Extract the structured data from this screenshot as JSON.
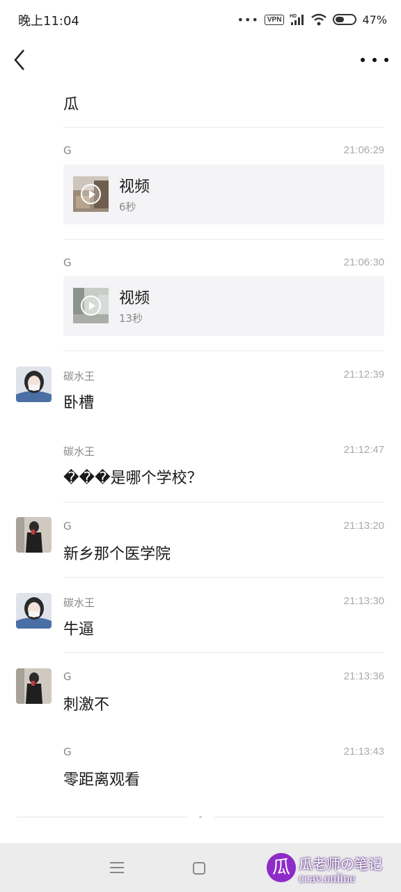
{
  "status_bar": {
    "time": "晚上11:04",
    "dots": "•••",
    "vpn": "VPN",
    "battery": "47%",
    "battery_level": 0.47
  },
  "messages": [
    {
      "text": "瓜"
    },
    {
      "sender": "G",
      "time": "21:06:29",
      "video": {
        "title": "视频",
        "duration": "6秒"
      }
    },
    {
      "sender": "G",
      "time": "21:06:30",
      "video": {
        "title": "视频",
        "duration": "13秒"
      }
    },
    {
      "sender": "碳水王",
      "time": "21:12:39",
      "text": "卧槽"
    },
    {
      "sender": "碳水王",
      "time": "21:12:47",
      "text": "���是哪个学校？"
    },
    {
      "sender": "G",
      "time": "21:13:20",
      "text": "新乡那个医学院"
    },
    {
      "sender": "碳水王",
      "time": "21:13:30",
      "text": "牛逼"
    },
    {
      "sender": "G",
      "time": "21:13:36",
      "text": "刺激不"
    },
    {
      "sender": "G",
      "time": "21:13:43",
      "text": "零距离观看"
    }
  ],
  "watermark": {
    "logo": "瓜",
    "title": "瓜老师の笔记",
    "url": "ccav.online"
  }
}
